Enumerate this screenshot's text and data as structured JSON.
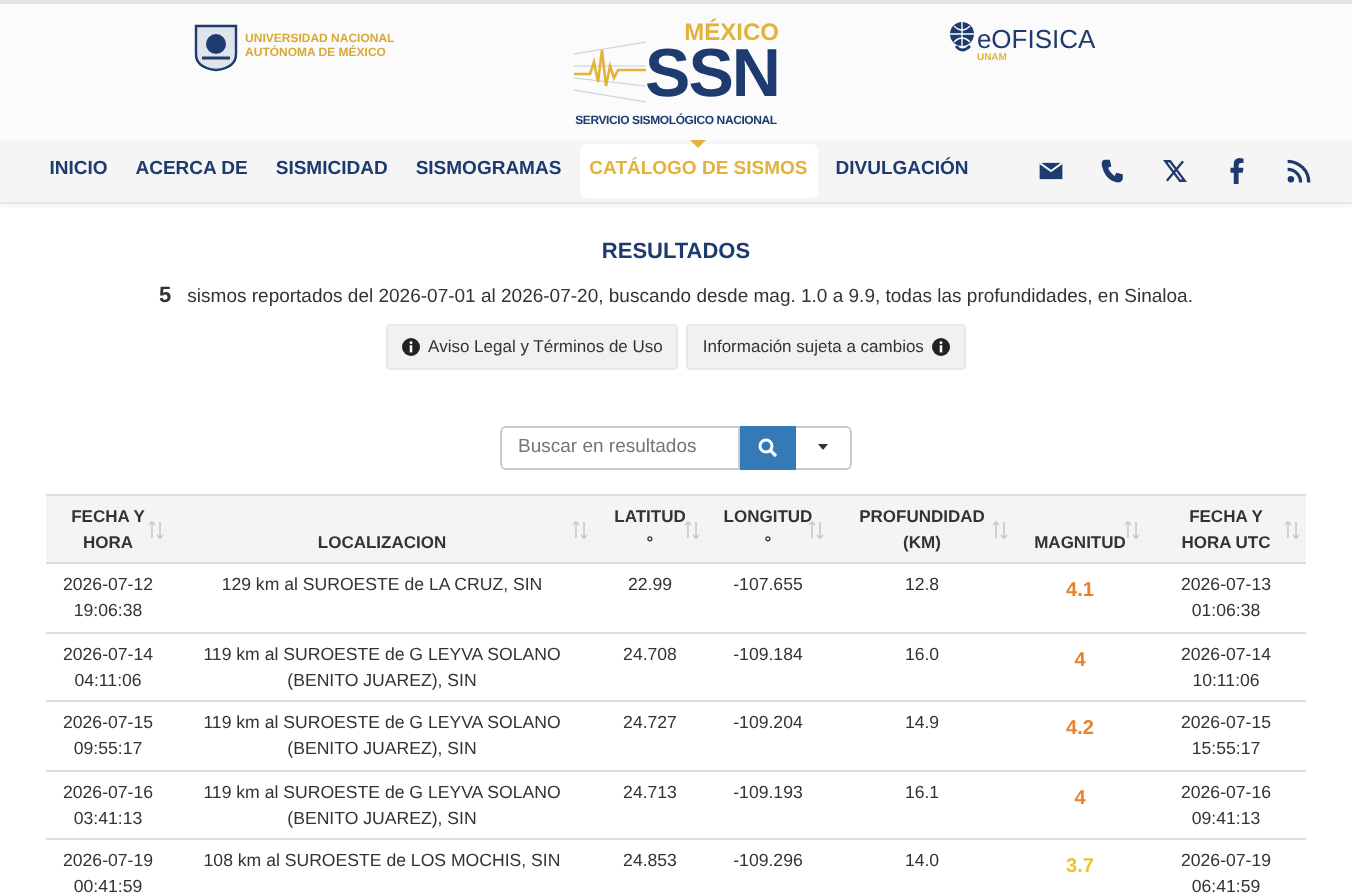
{
  "header": {
    "unam_text": [
      "UNIVERSIDAD NACIONAL",
      "AUTÓNOMA DE MÉXICO"
    ],
    "ssn": {
      "country": "MÉXICO",
      "acronym": "SSN",
      "name": "SERVICIO SISMOLÓGICO NACIONAL"
    },
    "geofisica": {
      "name": "eOFISICA",
      "sub": "UNAM"
    }
  },
  "nav": [
    {
      "label": "INICIO",
      "selected": false
    },
    {
      "label": "ACERCA DE",
      "selected": false
    },
    {
      "label": "SISMICIDAD",
      "selected": false
    },
    {
      "label": "SISMOGRAMAS",
      "selected": false
    },
    {
      "label": "CATÁLOGO DE SISMOS",
      "selected": true
    },
    {
      "label": "DIVULGACIÓN",
      "selected": false
    }
  ],
  "social": [
    {
      "kind": "mail"
    },
    {
      "kind": "phone"
    },
    {
      "kind": "x"
    },
    {
      "kind": "facebook"
    },
    {
      "kind": "rss"
    }
  ],
  "title": "RESULTADOS",
  "summary": {
    "count": "5",
    "text": "sismos reportados del 2026-07-01 al 2026-07-20, buscando desde mag. 1.0 a 9.9, todas las profundidades, en Sinaloa."
  },
  "notices": [
    {
      "label": "Aviso Legal y Términos de Uso",
      "icon_first": true
    },
    {
      "label": "Información sujeta a cambios",
      "icon_first": false
    }
  ],
  "search": {
    "placeholder": "Buscar en resultados"
  },
  "table": {
    "columns": [
      "FECHA Y\nHORA",
      "LOCALIZACION",
      "LATITUD\n°",
      "LONGITUD\n°",
      "PROFUNDIDAD\n(KM)",
      "MAGNITUD",
      "FECHA Y\nHORA UTC"
    ],
    "rows": [
      {
        "date": "2026-07-12\n19:06:38",
        "location": "129 km al SUROESTE de LA CRUZ, SIN",
        "lat": "22.99",
        "lon": "-107.655",
        "depth": "12.8",
        "mag": "4.1",
        "color": "#e8822a",
        "utc": "2026-07-13\n01:06:38"
      },
      {
        "date": "2026-07-14\n04:11:06",
        "location": "119 km al SUROESTE de G LEYVA SOLANO (BENITO JUAREZ), SIN",
        "lat": "24.708",
        "lon": "-109.184",
        "depth": "16.0",
        "mag": "4",
        "color": "#e8822a",
        "utc": "2026-07-14\n10:11:06"
      },
      {
        "date": "2026-07-15\n09:55:17",
        "location": "119 km al SUROESTE de G LEYVA SOLANO (BENITO JUAREZ), SIN",
        "lat": "24.727",
        "lon": "-109.204",
        "depth": "14.9",
        "mag": "4.2",
        "color": "#e8822a",
        "utc": "2026-07-15\n15:55:17"
      },
      {
        "date": "2026-07-16\n03:41:13",
        "location": "119 km al SUROESTE de G LEYVA SOLANO (BENITO JUAREZ), SIN",
        "lat": "24.713",
        "lon": "-109.193",
        "depth": "16.1",
        "mag": "4",
        "color": "#e8822a",
        "utc": "2026-07-16\n09:41:13"
      },
      {
        "date": "2026-07-19\n00:41:59",
        "location": "108 km al SUROESTE de LOS MOCHIS, SIN",
        "lat": "24.853",
        "lon": "-109.296",
        "depth": "14.0",
        "mag": "3.7",
        "color": "#f2c230",
        "utc": "2026-07-19\n06:41:59"
      }
    ]
  }
}
